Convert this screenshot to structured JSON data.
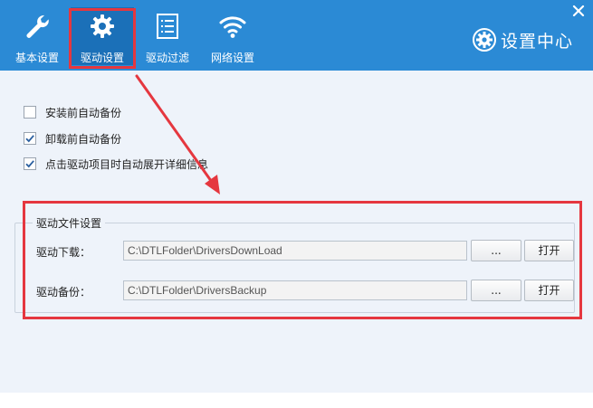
{
  "header": {
    "tabs": [
      {
        "label": "基本设置",
        "icon": "wrench-icon"
      },
      {
        "label": "驱动设置",
        "icon": "gear-icon",
        "active": true
      },
      {
        "label": "驱动过滤",
        "icon": "list-icon"
      },
      {
        "label": "网络设置",
        "icon": "wifi-icon"
      }
    ],
    "brand_label": "设置中心",
    "brand_icon": "gear-icon",
    "close_icon": "close-icon"
  },
  "options": [
    {
      "label": "安装前自动备份",
      "checked": false
    },
    {
      "label": "卸载前自动备份",
      "checked": true
    },
    {
      "label": "点击驱动项目时自动展开详细信息",
      "checked": true
    }
  ],
  "driver_files": {
    "title": "驱动文件设置",
    "download": {
      "label": "驱动下载：",
      "value": "C:\\DTLFolder\\DriversDownLoad",
      "browse_label": "...",
      "open_label": "打开"
    },
    "backup": {
      "label": "驱动备份：",
      "value": "C:\\DTLFolder\\DriversBackup",
      "browse_label": "...",
      "open_label": "打开"
    }
  },
  "colors": {
    "header": "#2b8ad5",
    "active_tab": "#1b70b8",
    "content_bg": "#eef3fa",
    "highlight": "#e5373f"
  }
}
